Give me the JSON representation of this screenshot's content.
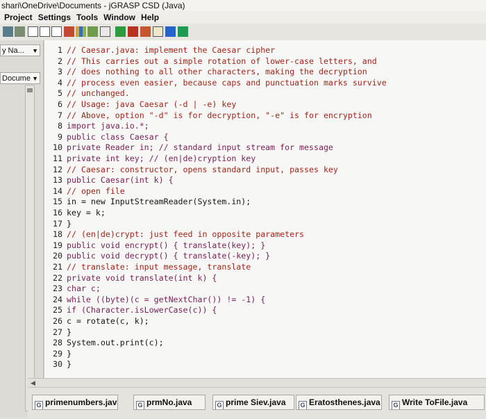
{
  "window": {
    "title": "shari\\OneDrive\\Documents - jGRASP CSD (Java)"
  },
  "menu": {
    "items": [
      "Project",
      "Settings",
      "Tools",
      "Window",
      "Help"
    ]
  },
  "left_pane": {
    "combo1": "y Na...",
    "combo2": "Docume"
  },
  "editor": {
    "lines": [
      {
        "n": "1",
        "t": "// Caesar.java: implement the Caesar cipher",
        "k": "cm"
      },
      {
        "n": "2",
        "t": "// This carries out a simple rotation of lower-case letters, and",
        "k": "cm"
      },
      {
        "n": "3",
        "t": "// does nothing to all other characters, making the decryption",
        "k": "cm"
      },
      {
        "n": "4",
        "t": "// process even easier, because caps and punctuation marks survive",
        "k": "cm"
      },
      {
        "n": "5",
        "t": "// unchanged.",
        "k": "cm"
      },
      {
        "n": "6",
        "t": "// Usage: java Caesar (-d | -e) key",
        "k": "cm"
      },
      {
        "n": "7",
        "t": "// Above, option \"-d\" is for decryption, \"-e\" is for encryption",
        "k": "cm"
      },
      {
        "n": "8",
        "t": "import java.io.*;",
        "k": "kw"
      },
      {
        "n": "9",
        "t": "public class Caesar {",
        "k": "kw"
      },
      {
        "n": "10",
        "t": "private Reader in; // standard input stream for message",
        "k": "kw"
      },
      {
        "n": "11",
        "t": "private int key; // (en|de)cryption key",
        "k": "kw"
      },
      {
        "n": "12",
        "t": "// Caesar: constructor, opens standard input, passes key",
        "k": "cm"
      },
      {
        "n": "13",
        "t": "public Caesar(int k) {",
        "k": "kw"
      },
      {
        "n": "14",
        "t": "// open file",
        "k": "cm"
      },
      {
        "n": "15",
        "t": "in = new InputStreamReader(System.in);",
        "k": "tx"
      },
      {
        "n": "16",
        "t": "key = k;",
        "k": "tx"
      },
      {
        "n": "17",
        "t": "}",
        "k": "tx"
      },
      {
        "n": "18",
        "t": "// (en|de)crypt: just feed in opposite parameters",
        "k": "cm"
      },
      {
        "n": "19",
        "t": "public void encrypt() { translate(key); }",
        "k": "kw"
      },
      {
        "n": "20",
        "t": "public void decrypt() { translate(-key); }",
        "k": "kw"
      },
      {
        "n": "21",
        "t": "// translate: input message, translate",
        "k": "cm"
      },
      {
        "n": "22",
        "t": "private void translate(int k) {",
        "k": "kw"
      },
      {
        "n": "23",
        "t": "char c;",
        "k": "kw"
      },
      {
        "n": "24",
        "t": "while ((byte)(c = getNextChar()) != -1) {",
        "k": "kw"
      },
      {
        "n": "25",
        "t": "if (Character.isLowerCase(c)) {",
        "k": "kw"
      },
      {
        "n": "26",
        "t": "c = rotate(c, k);",
        "k": "tx"
      },
      {
        "n": "27",
        "t": "}",
        "k": "tx"
      },
      {
        "n": "28",
        "t": "System.out.print(c);",
        "k": "tx"
      },
      {
        "n": "29",
        "t": "}",
        "k": "tx"
      },
      {
        "n": "30",
        "t": "}",
        "k": "tx"
      }
    ]
  },
  "tabs": [
    "primenumbers.java",
    "prmNo.java",
    "prime Siev.java",
    "Eratosthenes.java",
    "Write ToFile.java"
  ],
  "colors": {
    "comment": "#a0261a",
    "keyword": "#7a1f55",
    "text": "#151515",
    "editor_bg": "#f7f7f5"
  }
}
